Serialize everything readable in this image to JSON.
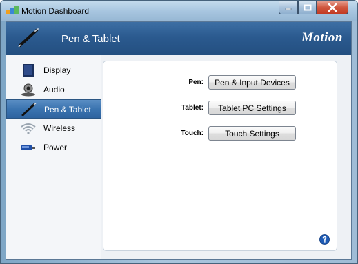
{
  "window": {
    "title": "Motion Dashboard",
    "controls": {
      "minimize": "minimize",
      "maximize": "maximize",
      "close": "close"
    }
  },
  "header": {
    "title": "Pen & Tablet",
    "brand": "Motion",
    "icon": "pen-icon"
  },
  "sidebar": {
    "items": [
      {
        "label": "Display",
        "icon": "display-icon",
        "selected": false
      },
      {
        "label": "Audio",
        "icon": "audio-icon",
        "selected": false
      },
      {
        "label": "Pen & Tablet",
        "icon": "pen-icon",
        "selected": true
      },
      {
        "label": "Wireless",
        "icon": "wireless-icon",
        "selected": false
      },
      {
        "label": "Power",
        "icon": "power-icon",
        "selected": false
      }
    ]
  },
  "panel": {
    "rows": [
      {
        "label": "Pen:",
        "button": "Pen & Input Devices"
      },
      {
        "label": "Tablet:",
        "button": "Tablet PC Settings"
      },
      {
        "label": "Touch:",
        "button": "Touch Settings"
      }
    ],
    "help_icon": "help-icon"
  },
  "colors": {
    "header_bg": "#2b5a8f",
    "selected_item": "#3b74b0",
    "close_button": "#c9432b"
  }
}
